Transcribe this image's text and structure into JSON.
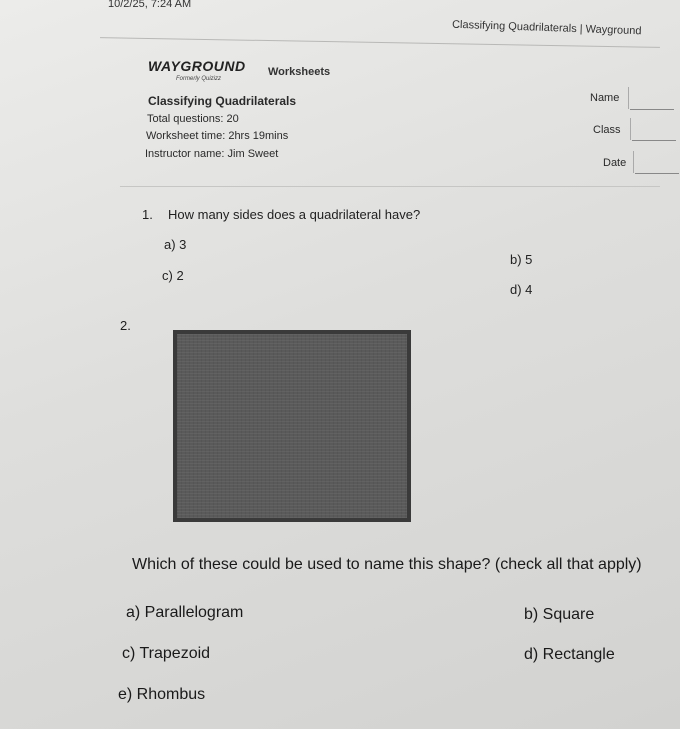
{
  "header": {
    "timestamp": "10/2/25, 7:24 AM",
    "page_title": "Classifying Quadrilaterals | Wayground"
  },
  "brand": {
    "logo": "WAYGROUND",
    "formerly": "Formerly Quizizz",
    "section": "Worksheets"
  },
  "worksheet": {
    "title": "Classifying Quadrilaterals",
    "total_questions": "Total questions: 20",
    "time": "Worksheet time: 2hrs 19mins",
    "instructor": "Instructor name: Jim Sweet"
  },
  "fields": {
    "name": "Name",
    "class": "Class",
    "date": "Date"
  },
  "q1": {
    "number": "1.",
    "text": "How many sides does a quadrilateral have?",
    "options": [
      "a) 3",
      "b) 5",
      "c) 2",
      "d) 4"
    ]
  },
  "q2": {
    "number": "2.",
    "text": "Which of these could be used to name this shape? (check all that apply)",
    "options": [
      "a) Parallelogram",
      "b) Square",
      "c) Trapezoid",
      "d) Rectangle",
      "e) Rhombus"
    ]
  }
}
